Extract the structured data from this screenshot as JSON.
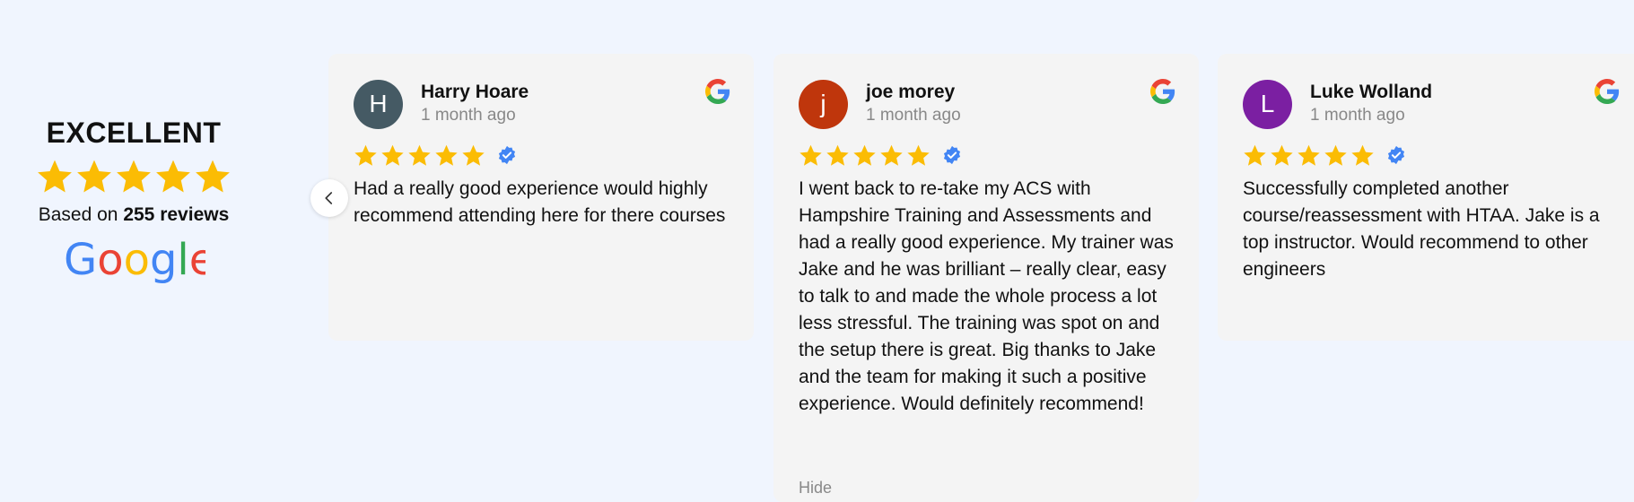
{
  "summary": {
    "rating_word": "EXCELLENT",
    "based_prefix": "Based on",
    "reviews_count": "255 reviews",
    "stars": 5
  },
  "colors": {
    "star": "#fbbc04",
    "verified": "#4285f4",
    "card_bg": "#f4f4f4",
    "page_bg": "#f0f5fe"
  },
  "reviews": [
    {
      "initial": "H",
      "name": "Harry Hoare",
      "time": "1 month ago",
      "avatar_color": "#455a64",
      "text": "Had a really good experience would highly recommend attending here for there courses"
    },
    {
      "initial": "j",
      "name": "joe morey",
      "time": "1 month ago",
      "avatar_color": "#bf360c",
      "text": "I went back to re-take my ACS with Hampshire Training and Assessments and had a really good experience. My trainer was Jake and he was brilliant – really clear, easy to talk to and made the whole process a lot less stressful. The training was spot on and the setup there is great. Big thanks to Jake and the team for making it such a positive experience. Would definitely recommend!",
      "more_label": "Hide"
    },
    {
      "initial": "L",
      "name": "Luke Wolland",
      "time": "1 month ago",
      "avatar_color": "#7b1fa2",
      "text": "Successfully completed another course/reassessment with HTAA. Jake is a top instructor. Would recommend to other engineers"
    }
  ],
  "icons": {
    "prev": "chevron-left-icon",
    "source": "google-g-icon",
    "verified": "verified-badge-icon",
    "star": "star-icon"
  }
}
